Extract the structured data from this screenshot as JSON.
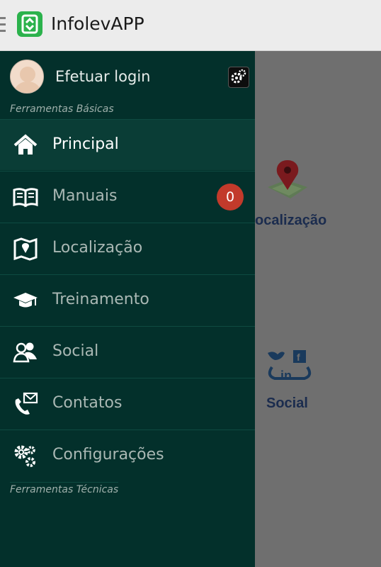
{
  "app": {
    "title": "InfolevAPP"
  },
  "drawer": {
    "profile": {
      "login_label": "Efetuar login"
    },
    "sections": {
      "basic": "Ferramentas Básicas",
      "technical": "Ferramentas Técnicas"
    },
    "items": [
      {
        "label": "Principal",
        "icon": "home-icon",
        "active": true
      },
      {
        "label": "Manuais",
        "icon": "book-icon",
        "badge": "0"
      },
      {
        "label": "Localização",
        "icon": "map-icon"
      },
      {
        "label": "Treinamento",
        "icon": "graduation-cap-icon"
      },
      {
        "label": "Social",
        "icon": "people-icon"
      },
      {
        "label": "Contatos",
        "icon": "phone-mail-icon"
      },
      {
        "label": "Configurações",
        "icon": "gears-icon"
      }
    ]
  },
  "background": {
    "tiles": [
      {
        "label": "ocalização",
        "icon": "map-pin-icon"
      },
      {
        "label": "Social",
        "icon": "social-networks-icon"
      }
    ]
  },
  "colors": {
    "drawer_bg": "#03302b",
    "badge": "#c23a2b",
    "app_logo": "#2bb24c"
  }
}
